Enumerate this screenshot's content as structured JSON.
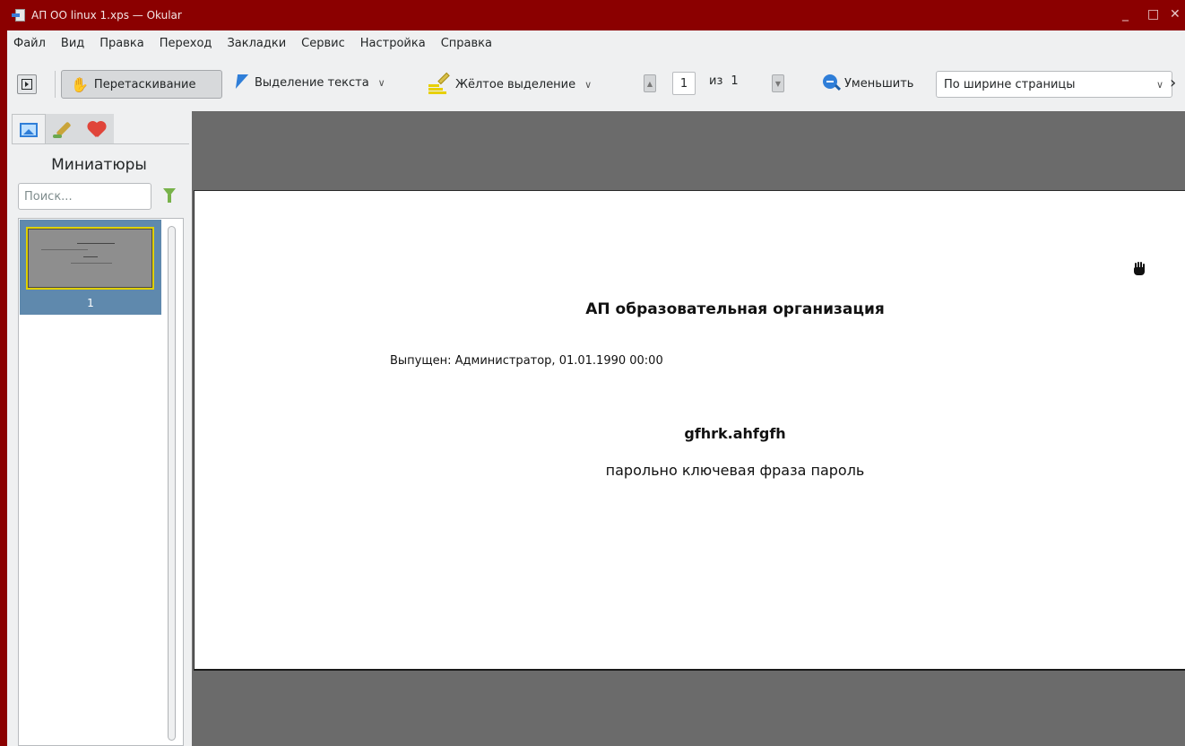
{
  "window": {
    "title": "АП ОО linux 1.xps — Okular",
    "controls": {
      "minimize": "_",
      "maximize": "□",
      "close": "✕"
    }
  },
  "menubar": {
    "items": [
      "Файл",
      "Вид",
      "Правка",
      "Переход",
      "Закладки",
      "Сервис",
      "Настройка",
      "Справка"
    ]
  },
  "toolbar": {
    "drag_label": "Перетаскивание",
    "select_text_label": "Выделение текста",
    "highlight_label": "Жёлтое выделение",
    "page_current": "1",
    "page_of": "из",
    "page_total": "1",
    "zoom_out_label": "Уменьшить",
    "zoom_mode": "По ширине страницы",
    "chevron": "∨",
    "more": "›"
  },
  "sidebar": {
    "title": "Миниатюры",
    "search_placeholder": "Поиск...",
    "thumbnails": [
      {
        "label": "1"
      }
    ]
  },
  "document": {
    "title": "АП образовательная организация",
    "issued": "Выпущен: Администратор, 01.01.1990 00:00",
    "key": "gfhrk.ahfgfh",
    "phrase": "парольно ключевая фраза пароль"
  },
  "colors": {
    "titlebar": "#8b0000",
    "accent": "#2f7ed8",
    "thumb_selected": "#5f89ad",
    "doc_background": "#6b6b6b"
  }
}
